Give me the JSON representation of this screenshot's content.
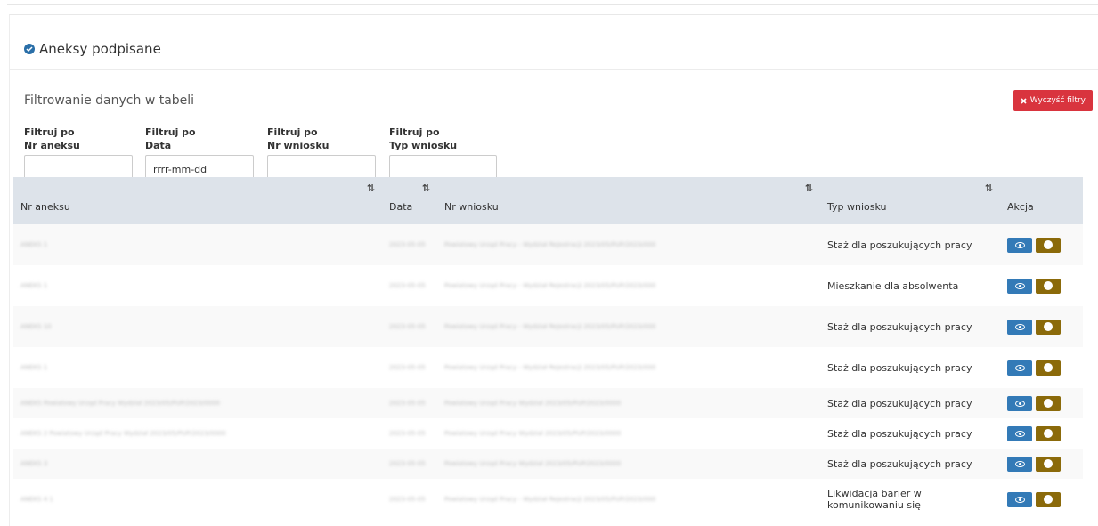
{
  "panel": {
    "title": "Aneksy podpisane"
  },
  "filters": {
    "section_title": "Filtrowanie danych w tabeli",
    "clear_label": "Wyczyść filtry",
    "items": [
      {
        "line1": "Filtruj po",
        "line2": "Nr aneksu",
        "value": ""
      },
      {
        "line1": "Filtruj po",
        "line2": "Data",
        "value": "",
        "placeholder": "rrrr-mm-dd"
      },
      {
        "line1": "Filtruj po",
        "line2": "Nr wniosku",
        "value": ""
      },
      {
        "line1": "Filtruj po",
        "line2": "Typ wniosku",
        "value": ""
      }
    ]
  },
  "table": {
    "headers": [
      "Nr aneksu",
      "Data",
      "Nr wniosku",
      "Typ wniosku",
      "Akcja"
    ],
    "rows": [
      {
        "nr_aneksu": "ANEKS 1",
        "data": "2023-05-05",
        "nr_wniosku": "Powiatowy Urząd Pracy - Wydział Rejestracji 2023/05/PUP/2023/000",
        "typ": "Staż dla poszukujących pracy"
      },
      {
        "nr_aneksu": "ANEKS 1",
        "data": "2023-05-05",
        "nr_wniosku": "Powiatowy Urząd Pracy - Wydział Rejestracji 2023/05/PUP/2023/000",
        "typ": "Mieszkanie dla absolwenta"
      },
      {
        "nr_aneksu": "ANEKS 10",
        "data": "2023-05-05",
        "nr_wniosku": "Powiatowy Urząd Pracy - Wydział Rejestracji 2023/05/PUP/2023/000",
        "typ": "Staż dla poszukujących pracy"
      },
      {
        "nr_aneksu": "ANEKS 1",
        "data": "2023-05-05",
        "nr_wniosku": "Powiatowy Urząd Pracy - Wydział Rejestracji 2023/05/PUP/2023/000",
        "typ": "Staż dla poszukujących pracy"
      },
      {
        "nr_aneksu": "ANEKS Powiatowy Urząd Pracy Wydział 2023/05/PUP/2023/0000",
        "data": "2023-05-05",
        "nr_wniosku": "Powiatowy Urząd Pracy Wydział 2023/05/PUP/2023/0000",
        "typ": "Staż dla poszukujących pracy"
      },
      {
        "nr_aneksu": "ANEKS 2 Powiatowy Urząd Pracy Wydział 2023/05/PUP/2023/0000",
        "data": "2023-05-05",
        "nr_wniosku": "Powiatowy Urząd Pracy Wydział 2023/05/PUP/2023/0000",
        "typ": "Staż dla poszukujących pracy"
      },
      {
        "nr_aneksu": "ANEKS 3",
        "data": "2023-05-05",
        "nr_wniosku": "Powiatowy Urząd Pracy Wydział 2023/05/PUP/2023/0000",
        "typ": "Staż dla poszukujących pracy"
      },
      {
        "nr_aneksu": "ANEKS 4 1",
        "data": "2023-05-05",
        "nr_wniosku": "Powiatowy Urząd Pracy - Wydział Rejestracji 2023/05/PUP/2023/000",
        "typ": "Likwidacja barier w komunikowaniu się"
      }
    ]
  },
  "colors": {
    "accent": "#337ab7",
    "danger": "#d9343e",
    "secondary_action": "#8b6a0a",
    "header_bg": "#dde3ea"
  },
  "icons": {
    "title": "check-circle-icon",
    "clear": "times-icon",
    "sort": "sort-icon",
    "view": "eye-icon",
    "settings": "gear-icon"
  }
}
